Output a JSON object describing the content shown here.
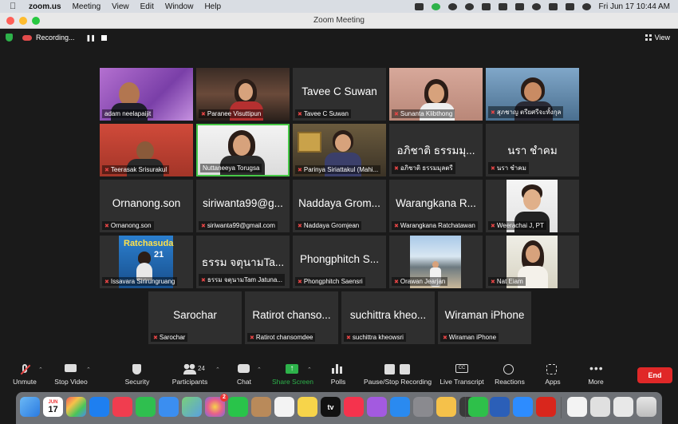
{
  "menubar": {
    "app_name": "zoom.us",
    "menus": [
      "Meeting",
      "View",
      "Edit",
      "Window",
      "Help"
    ],
    "clock": "Fri Jun 17  10:44 AM"
  },
  "window": {
    "title": "Zoom Meeting"
  },
  "topbar": {
    "recording_label": "Recording...",
    "view_label": "View"
  },
  "participants": [
    {
      "label": "adam neelapaijit",
      "display": ""
    },
    {
      "label": "Paranee Visuttipun",
      "display": ""
    },
    {
      "label": "Tavee C Suwan",
      "display": "Tavee C Suwan"
    },
    {
      "label": "Sunanta Klibthong",
      "display": ""
    },
    {
      "label": "สุภชาญ ตรียศรีจะทั้งกุล",
      "display": ""
    },
    {
      "label": "Teerasak Srisurakul",
      "display": ""
    },
    {
      "label": "Nuttaneeya Torugsa",
      "display": ""
    },
    {
      "label": "Parinya Siriattakul (Mahi...",
      "display": ""
    },
    {
      "label": "อภิชาติ ธรรมมุลตรี",
      "display": "อภิชาติ ธรรมมุ..."
    },
    {
      "label": "นรา ชำคม",
      "display": "นรา ชำคม"
    },
    {
      "label": "Ornanong.son",
      "display": "Ornanong.son"
    },
    {
      "label": "siriwanta99@gmail.com",
      "display": "siriwanta99@g..."
    },
    {
      "label": "Naddaya Gromjean",
      "display": "Naddaya Grom..."
    },
    {
      "label": "Warangkana Ratchatawan",
      "display": "Warangkana R..."
    },
    {
      "label": "Weerachai J, PT",
      "display": ""
    },
    {
      "label": "Issavara Sirirungruang",
      "display": ""
    },
    {
      "label": "ธรรม จตุนามTam Jatuna...",
      "display": "ธรรม จตุนามTa..."
    },
    {
      "label": "Phongphitch Saensri",
      "display": "Phongphitch S..."
    },
    {
      "label": "Orawan Jearjan",
      "display": ""
    },
    {
      "label": "Nat Eiam",
      "display": ""
    },
    {
      "label": "Sarochar",
      "display": "Sarochar"
    },
    {
      "label": "Ratirot chansomdee",
      "display": "Ratirot chanso..."
    },
    {
      "label": "suchittra kheowsri",
      "display": "suchittra kheo..."
    },
    {
      "label": "Wiraman iPhone",
      "display": "Wiraman iPhone"
    }
  ],
  "tile_extras": {
    "ratchasuda_banner": "Ratchasuda",
    "ratchasuda_number": "21"
  },
  "toolbar": {
    "unmute": "Unmute",
    "stop_video": "Stop Video",
    "security": "Security",
    "participants": "Participants",
    "participant_count": "24",
    "chat": "Chat",
    "share_screen": "Share Screen",
    "polls": "Polls",
    "pause_stop_recording": "Pause/Stop Recording",
    "live_transcript": "Live Transcript",
    "live_transcript_icon": "CC",
    "reactions": "Reactions",
    "apps": "Apps",
    "more": "More",
    "end": "End"
  },
  "dock": {
    "calendar_month": "JUN",
    "calendar_day": "17",
    "photos_badge": "2",
    "tv_label": "tv"
  },
  "colors": {
    "share_green": "#2db24a",
    "end_red": "#e02828",
    "active_speaker_border": "#47c847",
    "muted_mic": "#e64545"
  }
}
